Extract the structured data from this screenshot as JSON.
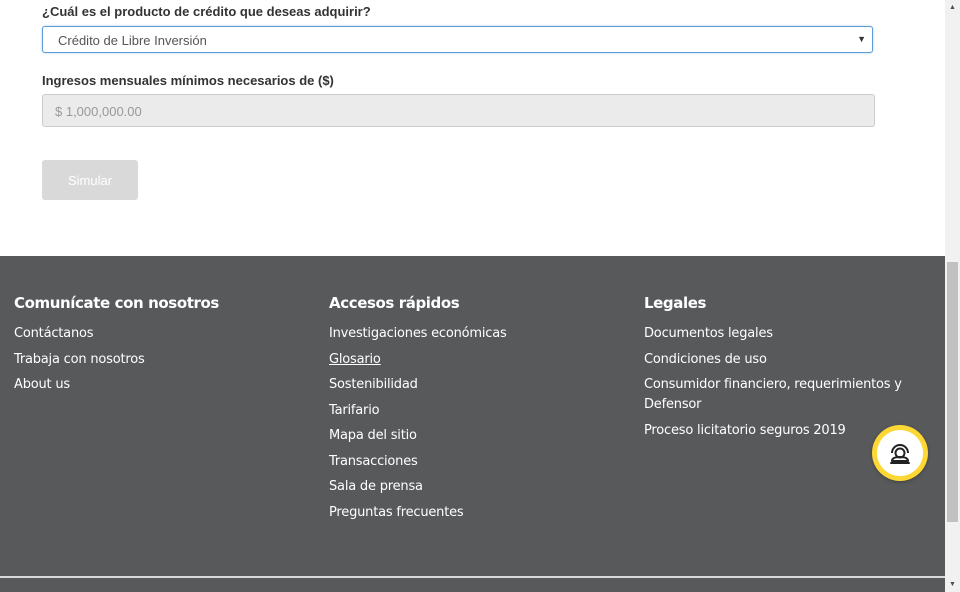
{
  "form": {
    "product_question": "¿Cuál es el producto de crédito que deseas adquirir?",
    "product_selected": "Crédito de Libre Inversión",
    "income_label": "Ingresos mensuales mínimos necesarios de ($)",
    "income_value": "$ 1,000,000.00",
    "simulate_button": "Simular"
  },
  "footer": {
    "contact": {
      "title": "Comunícate con nosotros",
      "items": [
        "Contáctanos",
        "Trabaja con nosotros",
        "About us"
      ]
    },
    "quick_access": {
      "title": "Accesos rápidos",
      "items": [
        "Investigaciones económicas",
        "Glosario",
        "Sostenibilidad",
        "Tarifario",
        "Mapa del sitio",
        "Transacciones",
        "Sala de prensa",
        "Preguntas frecuentes"
      ]
    },
    "legal": {
      "title": "Legales",
      "items": [
        "Documentos legales",
        "Condiciones de uso",
        "Consumidor financiero, requerimientos y Defensor",
        "Proceso licitatorio seguros 2019"
      ]
    }
  },
  "icons": {
    "chat": "support-agent-icon",
    "select_arrow": "chevron-down-icon"
  },
  "colors": {
    "footer_bg": "#58595b",
    "chat_accent": "#fdd835",
    "select_border": "#5b9dd9",
    "button_disabled": "#d9d9d9"
  }
}
